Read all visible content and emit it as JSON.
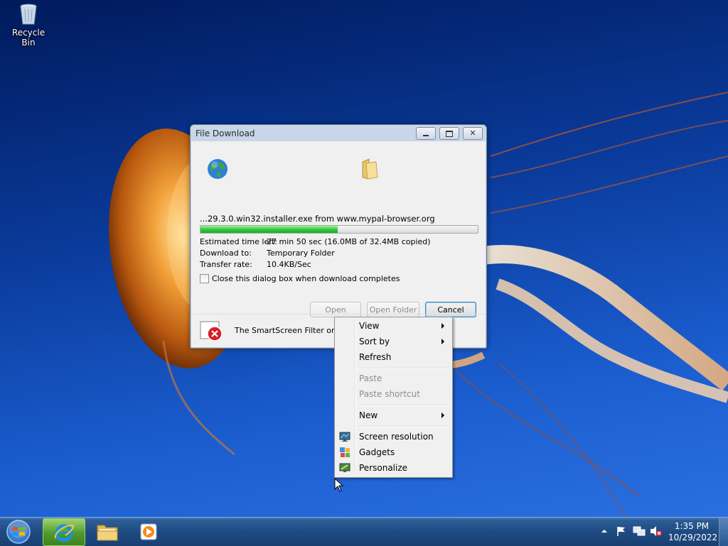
{
  "desktop": {
    "icons": [
      {
        "label": "Recycle Bin",
        "icon": "recycle-bin-icon"
      }
    ]
  },
  "download_dialog": {
    "title": "File Download",
    "controls": {
      "minimize": "minimize-icon",
      "maximize": "maximize-icon",
      "close": "close-icon"
    },
    "source_icon": "globe-icon",
    "dest_icon": "folder-icon",
    "filename_line": "...29.3.0.win32.installer.exe from www.mypal-browser.org",
    "progress_fraction": 0.494,
    "progress_color": "#2ec83a",
    "estimated_label": "Estimated time left:",
    "estimated_value": "27 min 50 sec (16.0MB of 32.4MB copied)",
    "download_to_label": "Download to:",
    "download_to_value": "Temporary Folder",
    "transfer_rate_label": "Transfer rate:",
    "transfer_rate_value": "10.4KB/Sec",
    "close_checkbox_label": "Close this dialog box when download completes",
    "close_checkbox_checked": false,
    "buttons": {
      "open": "Open",
      "open_folder": "Open Folder",
      "cancel": "Cancel"
    },
    "smartscreen_text": "The SmartScreen Filter online",
    "smartscreen_icon": "error-shield-icon"
  },
  "context_menu": {
    "items": [
      {
        "label": "View",
        "submenu": true,
        "enabled": true
      },
      {
        "label": "Sort by",
        "submenu": true,
        "enabled": true
      },
      {
        "label": "Refresh",
        "submenu": false,
        "enabled": true
      },
      {
        "label": "Paste",
        "submenu": false,
        "enabled": false
      },
      {
        "label": "Paste shortcut",
        "submenu": false,
        "enabled": false
      },
      {
        "label": "New",
        "submenu": true,
        "enabled": true
      },
      {
        "label": "Screen resolution",
        "icon": "screen-resolution-icon",
        "enabled": true
      },
      {
        "label": "Gadgets",
        "icon": "gadgets-icon",
        "enabled": true
      },
      {
        "label": "Personalize",
        "icon": "personalize-icon",
        "enabled": true
      }
    ]
  },
  "taskbar": {
    "start_icon": "windows-start-icon",
    "pinned": [
      {
        "name": "internet-explorer",
        "icon": "internet-explorer-icon",
        "active": true
      },
      {
        "name": "windows-explorer",
        "icon": "folder-icon",
        "active": false
      },
      {
        "name": "media-player",
        "icon": "media-player-icon",
        "active": false
      }
    ],
    "tray_icons": [
      "show-hidden-icons-icon",
      "action-center-flag-icon",
      "network-icon",
      "volume-muted-icon"
    ],
    "time": "1:35 PM",
    "date": "10/29/2022"
  }
}
